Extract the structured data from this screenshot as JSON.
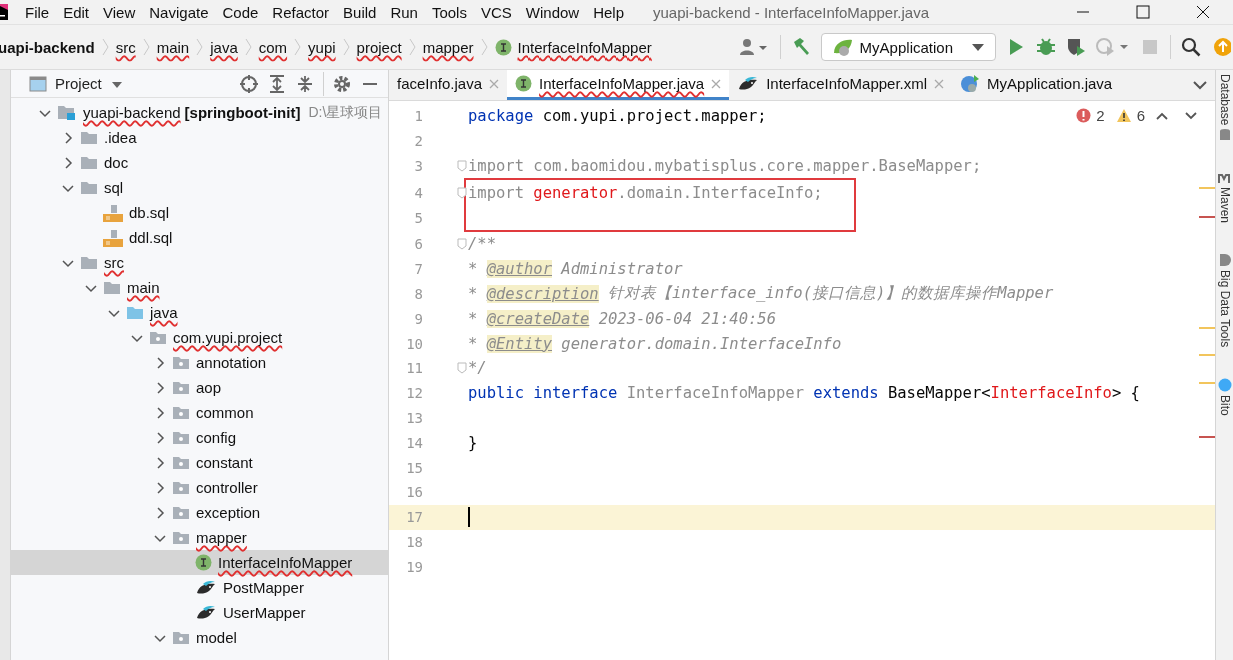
{
  "menu": [
    "File",
    "Edit",
    "View",
    "Navigate",
    "Code",
    "Refactor",
    "Build",
    "Run",
    "Tools",
    "VCS",
    "Window",
    "Help"
  ],
  "window": {
    "title": "yuapi-backend - InterfaceInfoMapper.java"
  },
  "breadcrumbs": [
    {
      "label": "uapi-backend",
      "kind": "project",
      "typo": false
    },
    {
      "label": "src",
      "kind": "dir",
      "typo": true
    },
    {
      "label": "main",
      "kind": "dir",
      "typo": true
    },
    {
      "label": "java",
      "kind": "dir",
      "typo": true
    },
    {
      "label": "com",
      "kind": "dir",
      "typo": true
    },
    {
      "label": "yupi",
      "kind": "dir",
      "typo": true
    },
    {
      "label": "project",
      "kind": "dir",
      "typo": true
    },
    {
      "label": "mapper",
      "kind": "dir",
      "typo": true
    },
    {
      "label": "InterfaceInfoMapper",
      "kind": "interface",
      "typo": true
    }
  ],
  "run_config": {
    "label": "MyApplication"
  },
  "project": {
    "title": "Project",
    "tree": [
      {
        "label": "yuapi-backend",
        "module": "[springboot-init]",
        "path": "D:\\星球项目",
        "kind": "module",
        "typo": true,
        "expanded": true,
        "selected": false,
        "children": [
          {
            "label": ".idea",
            "kind": "folder",
            "typo": false,
            "expanded": false,
            "selected": false
          },
          {
            "label": "doc",
            "kind": "folder",
            "typo": false,
            "expanded": false,
            "selected": false
          },
          {
            "label": "sql",
            "kind": "folder",
            "typo": false,
            "expanded": true,
            "selected": false,
            "children": [
              {
                "label": "db.sql",
                "kind": "sql",
                "typo": false,
                "selected": false
              },
              {
                "label": "ddl.sql",
                "kind": "sql",
                "typo": false,
                "selected": false
              }
            ]
          },
          {
            "label": "src",
            "kind": "folder",
            "typo": true,
            "expanded": true,
            "selected": false,
            "children": [
              {
                "label": "main",
                "kind": "folder",
                "typo": true,
                "expanded": true,
                "selected": false,
                "children": [
                  {
                    "label": "java",
                    "kind": "source",
                    "typo": true,
                    "expanded": true,
                    "selected": false,
                    "children": [
                      {
                        "label": "com.yupi.project",
                        "kind": "package",
                        "typo": true,
                        "expanded": true,
                        "selected": false,
                        "children": [
                          {
                            "label": "annotation",
                            "kind": "package",
                            "typo": false,
                            "expanded": false,
                            "selected": false
                          },
                          {
                            "label": "aop",
                            "kind": "package",
                            "typo": false,
                            "expanded": false,
                            "selected": false
                          },
                          {
                            "label": "common",
                            "kind": "package",
                            "typo": false,
                            "expanded": false,
                            "selected": false
                          },
                          {
                            "label": "config",
                            "kind": "package",
                            "typo": false,
                            "expanded": false,
                            "selected": false
                          },
                          {
                            "label": "constant",
                            "kind": "package",
                            "typo": false,
                            "expanded": false,
                            "selected": false
                          },
                          {
                            "label": "controller",
                            "kind": "package",
                            "typo": false,
                            "expanded": false,
                            "selected": false
                          },
                          {
                            "label": "exception",
                            "kind": "package",
                            "typo": false,
                            "expanded": false,
                            "selected": false
                          },
                          {
                            "label": "mapper",
                            "kind": "package",
                            "typo": true,
                            "expanded": true,
                            "selected": false,
                            "children": [
                              {
                                "label": "InterfaceInfoMapper",
                                "kind": "interface",
                                "typo": true,
                                "selected": true
                              },
                              {
                                "label": "PostMapper",
                                "kind": "mybatis",
                                "typo": false,
                                "selected": false
                              },
                              {
                                "label": "UserMapper",
                                "kind": "mybatis",
                                "typo": false,
                                "selected": false
                              }
                            ]
                          },
                          {
                            "label": "model",
                            "kind": "package",
                            "typo": false,
                            "expanded": true,
                            "selected": false
                          }
                        ]
                      }
                    ]
                  }
                ]
              }
            ]
          }
        ]
      }
    ]
  },
  "tabs": [
    {
      "label": "faceInfo.java",
      "kind": "plain",
      "selected": false,
      "typo": false,
      "closable": true
    },
    {
      "label": "InterfaceInfoMapper.java",
      "kind": "interface",
      "selected": true,
      "typo": true,
      "closable": true
    },
    {
      "label": "InterfaceInfoMapper.xml",
      "kind": "mybatis",
      "selected": false,
      "typo": false,
      "closable": true
    },
    {
      "label": "MyApplication.java",
      "kind": "spring",
      "selected": false,
      "typo": false,
      "closable": false
    }
  ],
  "inspections": {
    "errors": "2",
    "warnings": "6"
  },
  "code": {
    "lines": [
      {
        "number": "1",
        "fold": false,
        "boxed": false,
        "current": false,
        "tokens": [
          {
            "kind": "keyword",
            "text": "package"
          },
          {
            "kind": "plain",
            "text": " com.yupi.project.mapper;"
          }
        ]
      },
      {
        "number": "2",
        "fold": false,
        "boxed": false,
        "current": false
      },
      {
        "number": "3",
        "fold": true,
        "boxed": false,
        "current": false,
        "tokens": [
          {
            "kind": "unused",
            "text": "import com.baomidou.mybatisplus.core.mapper.BaseMapper;"
          }
        ]
      },
      {
        "number": "4",
        "fold": true,
        "boxed": true,
        "current": false,
        "tokens": [
          {
            "kind": "unused",
            "text": "import "
          },
          {
            "kind": "error",
            "text": "generator"
          },
          {
            "kind": "unused",
            "text": ".domain.InterfaceInfo;"
          }
        ]
      },
      {
        "number": "5",
        "fold": false,
        "boxed": true,
        "current": false
      },
      {
        "number": "6",
        "fold": true,
        "boxed": false,
        "current": false,
        "tokens": [
          {
            "kind": "comment",
            "text": "/**"
          }
        ]
      },
      {
        "number": "7",
        "fold": false,
        "boxed": false,
        "current": false,
        "tokens": [
          {
            "kind": "comment",
            "text": "* "
          },
          {
            "kind": "doctag",
            "text": "@author"
          },
          {
            "kind": "comment",
            "text": " Administrator"
          }
        ]
      },
      {
        "number": "8",
        "fold": false,
        "boxed": false,
        "current": false,
        "tokens": [
          {
            "kind": "comment",
            "text": "* "
          },
          {
            "kind": "doctag",
            "text": "@description"
          },
          {
            "kind": "comment",
            "text": " 针对表【interface_info(接口信息)】的数据库操作Mapper"
          }
        ]
      },
      {
        "number": "9",
        "fold": false,
        "boxed": false,
        "current": false,
        "tokens": [
          {
            "kind": "comment",
            "text": "* "
          },
          {
            "kind": "doctag",
            "text": "@createDate"
          },
          {
            "kind": "comment",
            "text": " 2023-06-04 21:40:56"
          }
        ]
      },
      {
        "number": "10",
        "fold": false,
        "boxed": false,
        "current": false,
        "tokens": [
          {
            "kind": "comment",
            "text": "* "
          },
          {
            "kind": "doctag",
            "text": "@Entity"
          },
          {
            "kind": "comment",
            "text": " generator.domain.InterfaceInfo"
          }
        ]
      },
      {
        "number": "11",
        "fold": true,
        "boxed": false,
        "current": false,
        "tokens": [
          {
            "kind": "comment",
            "text": "*/"
          }
        ]
      },
      {
        "number": "12",
        "fold": false,
        "boxed": false,
        "current": false,
        "tokens": [
          {
            "kind": "keyword",
            "text": "public"
          },
          {
            "kind": "keyword",
            "text": " interface"
          },
          {
            "kind": "unused",
            "text": " InterfaceInfoMapper"
          },
          {
            "kind": "keyword",
            "text": " extends"
          },
          {
            "kind": "plain",
            "text": " BaseMapper<"
          },
          {
            "kind": "error",
            "text": "InterfaceInfo"
          },
          {
            "kind": "plain",
            "text": "> {"
          }
        ]
      },
      {
        "number": "13",
        "fold": false,
        "boxed": false,
        "current": false
      },
      {
        "number": "14",
        "fold": false,
        "boxed": false,
        "current": false,
        "tokens": [
          {
            "kind": "plain",
            "text": "}"
          }
        ]
      },
      {
        "number": "15",
        "fold": false,
        "boxed": false,
        "current": false
      },
      {
        "number": "16",
        "fold": false,
        "boxed": false,
        "current": false
      },
      {
        "number": "17",
        "fold": false,
        "boxed": false,
        "current": true
      },
      {
        "number": "18",
        "fold": false,
        "boxed": false,
        "current": false
      },
      {
        "number": "19",
        "fold": false,
        "boxed": false,
        "current": false
      }
    ]
  },
  "tool_windows": [
    {
      "label": "Database",
      "kind": "database"
    },
    {
      "label": "Maven",
      "kind": "maven"
    },
    {
      "label": "Big Data Tools",
      "kind": "bigdata"
    },
    {
      "label": "Bito",
      "kind": "bito"
    }
  ]
}
